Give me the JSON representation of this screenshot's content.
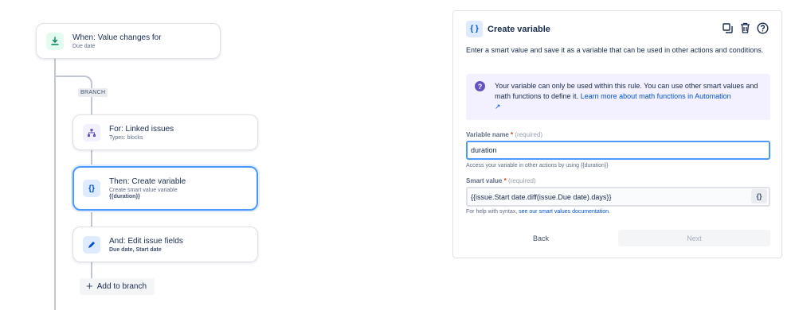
{
  "trigger": {
    "title": "When: Value changes for",
    "subtitle": "Due date",
    "icon": "trigger-download-icon",
    "color": "#36b37e"
  },
  "branch": {
    "tag": "BRANCH"
  },
  "branch_card": {
    "title": "For: Linked issues",
    "subtitle": "Types: blocks",
    "icon": "hierarchy-icon"
  },
  "create_card": {
    "title": "Then: Create variable",
    "subtitle": "Create smart value variable",
    "variable": "{{duration}}",
    "icon": "curly-braces-icon"
  },
  "edit_card": {
    "title": "And: Edit issue fields",
    "fields": "Due date, Start date",
    "icon": "pencil-icon"
  },
  "add_branch": {
    "label": "Add to branch"
  },
  "panel": {
    "title": "Create variable",
    "icon_label": "{ }",
    "description": "Enter a smart value and save it as a variable that can be used in other actions and conditions.",
    "info_text": "Your variable can only be used within this rule. You can use other smart values and math functions to define it.",
    "info_link": "Learn more about math functions in Automation",
    "info_link_arrow": "↗",
    "variable_name_label": "Variable name",
    "variable_name_required": "(required)",
    "variable_name_value": "duration",
    "variable_name_help": "Access your variable in other actions by using {{duration}}",
    "smart_value_label": "Smart value",
    "smart_value_required": "(required)",
    "smart_value_value": "{{issue.Start date.diff(issue.Due date).days}}",
    "smart_value_button": "{}",
    "smart_value_help": "For help with syntax,",
    "smart_value_help_link": "see our smart values documentation",
    "smart_value_help_end": ".",
    "back_label": "Back",
    "next_label": "Next"
  },
  "colors": {
    "accent": "#0052cc",
    "selected_border": "#4c9aff",
    "info_bg": "#f3f0ff",
    "info_icon": "#6554c0"
  }
}
